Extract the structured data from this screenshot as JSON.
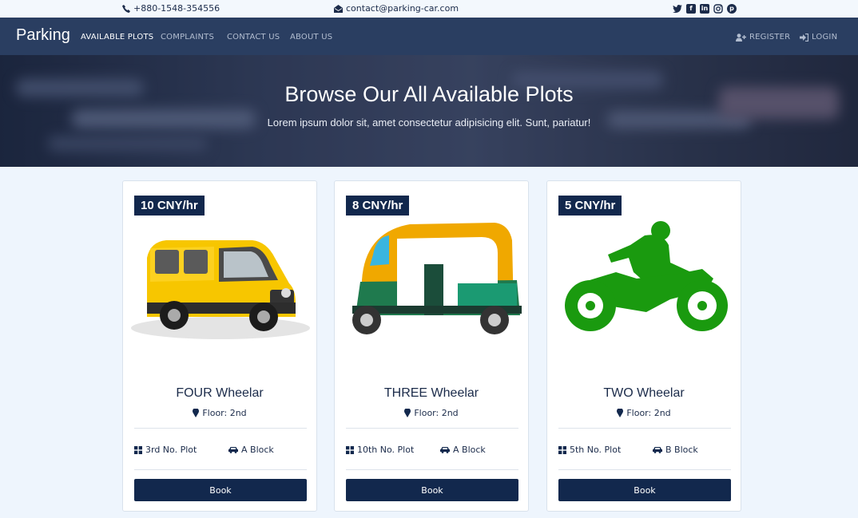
{
  "topbar": {
    "phone": "+880-1548-354556",
    "email": "contact@parking-car.com",
    "social_icons": [
      "twitter-icon",
      "facebook-icon",
      "linkedin-icon",
      "instagram-icon",
      "pinterest-icon"
    ]
  },
  "nav": {
    "brand": "Parking",
    "links": [
      "AVAILABLE PLOTS",
      "COMPLAINTS",
      "CONTACT US",
      "ABOUT US"
    ],
    "active": "AVAILABLE PLOTS",
    "register": "REGISTER",
    "login": "LOGIN"
  },
  "hero": {
    "title": "Browse Our All Available Plots",
    "subtitle": "Lorem ipsum dolor sit, amet consectetur adipisicing elit. Sunt, pariatur!"
  },
  "cards": [
    {
      "price": "10 CNY/hr",
      "title": "FOUR Wheelar",
      "floor": "Floor: 2nd",
      "plot": "3rd No. Plot",
      "block": "A Block",
      "button": "Book",
      "image": "yellow-van"
    },
    {
      "price": "8 CNY/hr",
      "title": "THREE Wheelar",
      "floor": "Floor: 2nd",
      "plot": "10th No. Plot",
      "block": "A Block",
      "button": "Book",
      "image": "auto-rickshaw"
    },
    {
      "price": "5 CNY/hr",
      "title": "TWO Wheelar",
      "floor": "Floor: 2nd",
      "plot": "5th No. Plot",
      "block": "B Block",
      "button": "Book",
      "image": "green-motorbike-silhouette"
    }
  ],
  "colors": {
    "navbar": "#2a3e61",
    "accent": "#12284d",
    "page_bg": "#eef5fd",
    "van": "#f7c600",
    "rickshaw_top": "#f0a800",
    "rickshaw_body": "#1f7a4e",
    "bike": "#1a9a0f"
  }
}
